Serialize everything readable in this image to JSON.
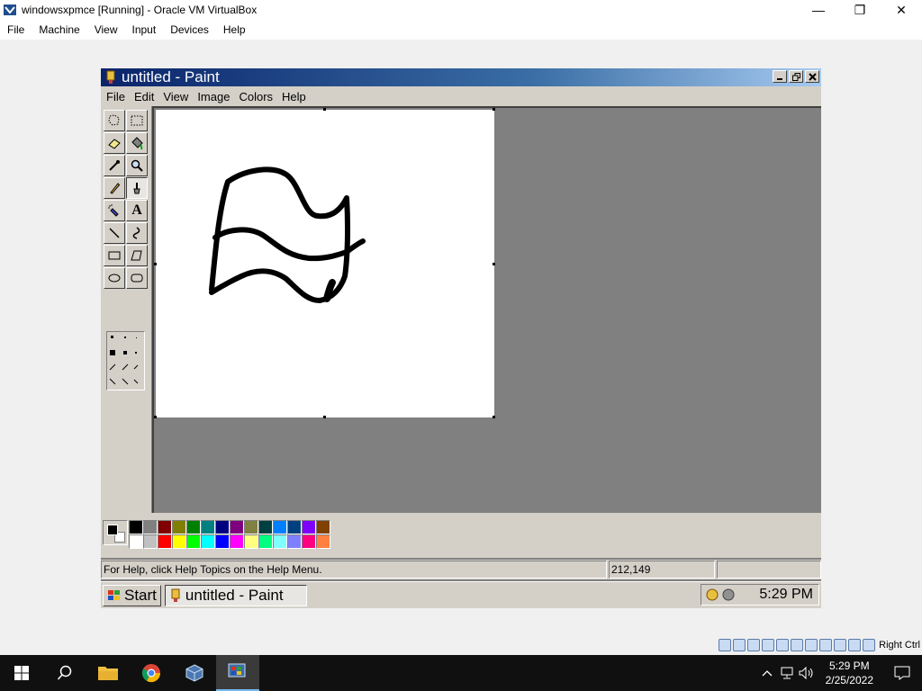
{
  "host_window": {
    "title": "windowsxpmce [Running] - Oracle VM VirtualBox",
    "controls": {
      "minimize": "—",
      "restore": "❐",
      "close": "✕"
    },
    "menu": [
      "File",
      "Machine",
      "View",
      "Input",
      "Devices",
      "Help"
    ],
    "host_key_label": "Right Ctrl"
  },
  "paint": {
    "title": "untitled - Paint",
    "menu": [
      "File",
      "Edit",
      "View",
      "Image",
      "Colors",
      "Help"
    ],
    "tools": [
      "free-select-icon",
      "select-icon",
      "eraser-icon",
      "fill-icon",
      "color-picker-icon",
      "magnifier-icon",
      "pencil-icon",
      "brush-icon",
      "airbrush-icon",
      "text-icon",
      "line-icon",
      "curve-icon",
      "rectangle-icon",
      "polygon-icon",
      "ellipse-icon",
      "rounded-rectangle-icon"
    ],
    "active_tool": "pencil-icon",
    "text_tool_glyph": "A",
    "palette": {
      "foreground": "#000000",
      "background": "#ffffff",
      "row1": [
        "#000000",
        "#808080",
        "#800000",
        "#808000",
        "#008000",
        "#008080",
        "#000080",
        "#800080",
        "#808040",
        "#004040",
        "#0080ff",
        "#004080",
        "#8000ff",
        "#804000"
      ],
      "row2": [
        "#ffffff",
        "#c0c0c0",
        "#ff0000",
        "#ffff00",
        "#00ff00",
        "#00ffff",
        "#0000ff",
        "#ff00ff",
        "#ffff80",
        "#00ff80",
        "#80ffff",
        "#8080ff",
        "#ff0080",
        "#ff8040"
      ]
    },
    "status": {
      "help": "For Help, click Help Topics on the Help Menu.",
      "coords": "212,149",
      "size": ""
    }
  },
  "xp_taskbar": {
    "start_label": "Start",
    "task_label": "untitled - Paint",
    "clock": "5:29 PM"
  },
  "win10_taskbar": {
    "time": "5:29 PM",
    "date": "2/25/2022"
  }
}
